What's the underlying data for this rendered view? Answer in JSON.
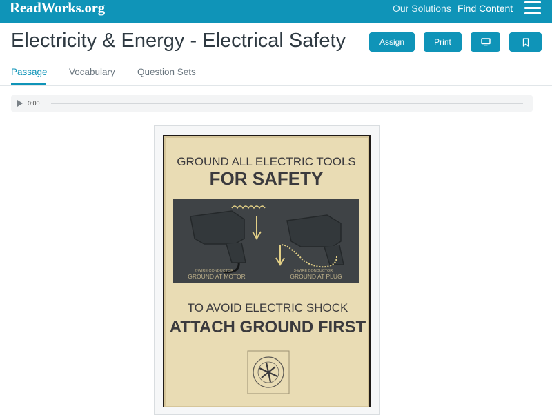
{
  "header": {
    "logo": "ReadWorks.org",
    "nav": [
      {
        "label": "Our Solutions"
      },
      {
        "label": "Find Content"
      }
    ]
  },
  "page": {
    "title": "Electricity & Energy - Electrical Safety"
  },
  "actions": {
    "assign": "Assign",
    "print": "Print"
  },
  "tabs": [
    {
      "label": "Passage",
      "active": true
    },
    {
      "label": "Vocabulary"
    },
    {
      "label": "Question Sets"
    }
  ],
  "audio": {
    "time": "0:00",
    "progress": 0
  },
  "poster": {
    "line1": "GROUND ALL ELECTRIC TOOLS",
    "line2": "FOR SAFETY",
    "left_caption_small": "2-WIRE CONDUCTOR",
    "left_caption": "GROUND AT MOTOR",
    "right_caption_small": "3-WIRE CONDUCTOR",
    "right_caption": "GROUND AT PLUG",
    "line3": "TO AVOID ELECTRIC SHOCK",
    "line4": "ATTACH GROUND FIRST"
  },
  "colors": {
    "brand": "#0f94b8",
    "poster_paper": "#e9dcb4",
    "poster_ink": "#3b3a3d"
  }
}
